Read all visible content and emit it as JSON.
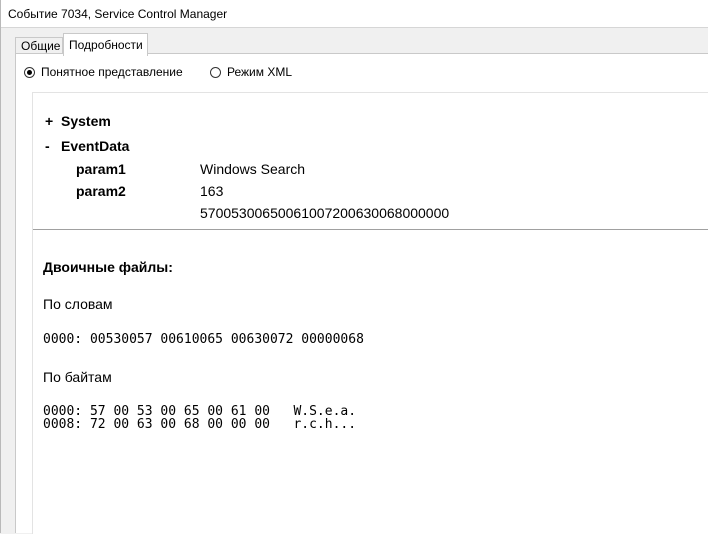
{
  "window": {
    "title": "Событие 7034, Service Control Manager"
  },
  "tabs": [
    {
      "label": "Общие",
      "active": false
    },
    {
      "label": "Подробности",
      "active": true
    }
  ],
  "view_mode": {
    "options": [
      {
        "label": "Понятное представление",
        "selected": true
      },
      {
        "label": "Режим XML",
        "selected": false
      }
    ]
  },
  "tree": {
    "system": {
      "toggle": "+",
      "label": "System"
    },
    "eventdata": {
      "toggle": "-",
      "label": "EventData",
      "params": [
        {
          "name": "param1",
          "value": "Windows Search"
        },
        {
          "name": "param2",
          "value": "163"
        }
      ],
      "binary_value": "57005300650061007200630068000000"
    }
  },
  "binary": {
    "heading": "Двоичные файлы:",
    "words_label": "По словам",
    "words_lines": [
      "0000: 00530057 00610065 00630072 00000068"
    ],
    "bytes_label": "По байтам",
    "bytes_lines": [
      "0000: 57 00 53 00 65 00 61 00   W.S.e.a.",
      "0008: 72 00 63 00 68 00 00 00   r.c.h..."
    ]
  }
}
